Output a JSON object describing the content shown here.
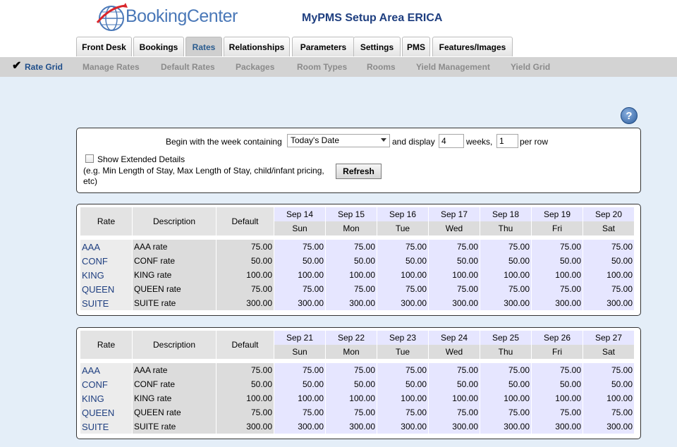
{
  "header": {
    "logo_text": "BookingCenter",
    "site_title": "MyPMS Setup Area ERICA"
  },
  "tabs": [
    {
      "label": "Front Desk"
    },
    {
      "label": "Bookings"
    },
    {
      "label": "Rates",
      "active": true
    },
    {
      "label": "Relationships"
    },
    {
      "label": "Parameters"
    },
    {
      "label": "Settings"
    },
    {
      "label": "PMS"
    },
    {
      "label": "Features/Images"
    }
  ],
  "subnav": {
    "check_icon": "✔",
    "items": [
      {
        "label": "Rate Grid",
        "active": true
      },
      {
        "label": "Manage Rates"
      },
      {
        "label": "Default Rates"
      },
      {
        "label": "Packages"
      },
      {
        "label": "Room Types"
      },
      {
        "label": "Rooms"
      },
      {
        "label": "Yield Management"
      },
      {
        "label": "Yield Grid"
      }
    ]
  },
  "help_icon": "?",
  "options": {
    "begin_label": "Begin with the week containing",
    "week_select": "Today's Date",
    "and_display": "and display",
    "weeks_value": "4",
    "weeks_label": "weeks,",
    "per_row_value": "1",
    "per_row_label": "per row",
    "extended_label": "Show Extended Details",
    "extended_note": "(e.g. Min Length of Stay, Max Length of Stay, child/infant pricing, etc)",
    "refresh": "Refresh"
  },
  "table_headers": {
    "rate": "Rate",
    "description": "Description",
    "default": "Default"
  },
  "grids": [
    {
      "days": [
        {
          "date": "Sep 14",
          "dow": "Sun"
        },
        {
          "date": "Sep 15",
          "dow": "Mon"
        },
        {
          "date": "Sep 16",
          "dow": "Tue"
        },
        {
          "date": "Sep 17",
          "dow": "Wed"
        },
        {
          "date": "Sep 18",
          "dow": "Thu"
        },
        {
          "date": "Sep 19",
          "dow": "Fri"
        },
        {
          "date": "Sep 20",
          "dow": "Sat"
        }
      ],
      "rows": [
        {
          "rate": "AAA",
          "desc": "AAA rate",
          "default": "75.00",
          "values": [
            "75.00",
            "75.00",
            "75.00",
            "75.00",
            "75.00",
            "75.00",
            "75.00"
          ]
        },
        {
          "rate": "CONF",
          "desc": "CONF rate",
          "default": "50.00",
          "values": [
            "50.00",
            "50.00",
            "50.00",
            "50.00",
            "50.00",
            "50.00",
            "50.00"
          ]
        },
        {
          "rate": "KING",
          "desc": "KING rate",
          "default": "100.00",
          "values": [
            "100.00",
            "100.00",
            "100.00",
            "100.00",
            "100.00",
            "100.00",
            "100.00"
          ]
        },
        {
          "rate": "QUEEN",
          "desc": "QUEEN rate",
          "default": "75.00",
          "values": [
            "75.00",
            "75.00",
            "75.00",
            "75.00",
            "75.00",
            "75.00",
            "75.00"
          ]
        },
        {
          "rate": "SUITE",
          "desc": "SUITE rate",
          "default": "300.00",
          "values": [
            "300.00",
            "300.00",
            "300.00",
            "300.00",
            "300.00",
            "300.00",
            "300.00"
          ]
        }
      ]
    },
    {
      "days": [
        {
          "date": "Sep 21",
          "dow": "Sun"
        },
        {
          "date": "Sep 22",
          "dow": "Mon"
        },
        {
          "date": "Sep 23",
          "dow": "Tue"
        },
        {
          "date": "Sep 24",
          "dow": "Wed"
        },
        {
          "date": "Sep 25",
          "dow": "Thu"
        },
        {
          "date": "Sep 26",
          "dow": "Fri"
        },
        {
          "date": "Sep 27",
          "dow": "Sat"
        }
      ],
      "rows": [
        {
          "rate": "AAA",
          "desc": "AAA rate",
          "default": "75.00",
          "values": [
            "75.00",
            "75.00",
            "75.00",
            "75.00",
            "75.00",
            "75.00",
            "75.00"
          ]
        },
        {
          "rate": "CONF",
          "desc": "CONF rate",
          "default": "50.00",
          "values": [
            "50.00",
            "50.00",
            "50.00",
            "50.00",
            "50.00",
            "50.00",
            "50.00"
          ]
        },
        {
          "rate": "KING",
          "desc": "KING rate",
          "default": "100.00",
          "values": [
            "100.00",
            "100.00",
            "100.00",
            "100.00",
            "100.00",
            "100.00",
            "100.00"
          ]
        },
        {
          "rate": "QUEEN",
          "desc": "QUEEN rate",
          "default": "75.00",
          "values": [
            "75.00",
            "75.00",
            "75.00",
            "75.00",
            "75.00",
            "75.00",
            "75.00"
          ]
        },
        {
          "rate": "SUITE",
          "desc": "SUITE rate",
          "default": "300.00",
          "values": [
            "300.00",
            "300.00",
            "300.00",
            "300.00",
            "300.00",
            "300.00",
            "300.00"
          ]
        }
      ]
    }
  ]
}
